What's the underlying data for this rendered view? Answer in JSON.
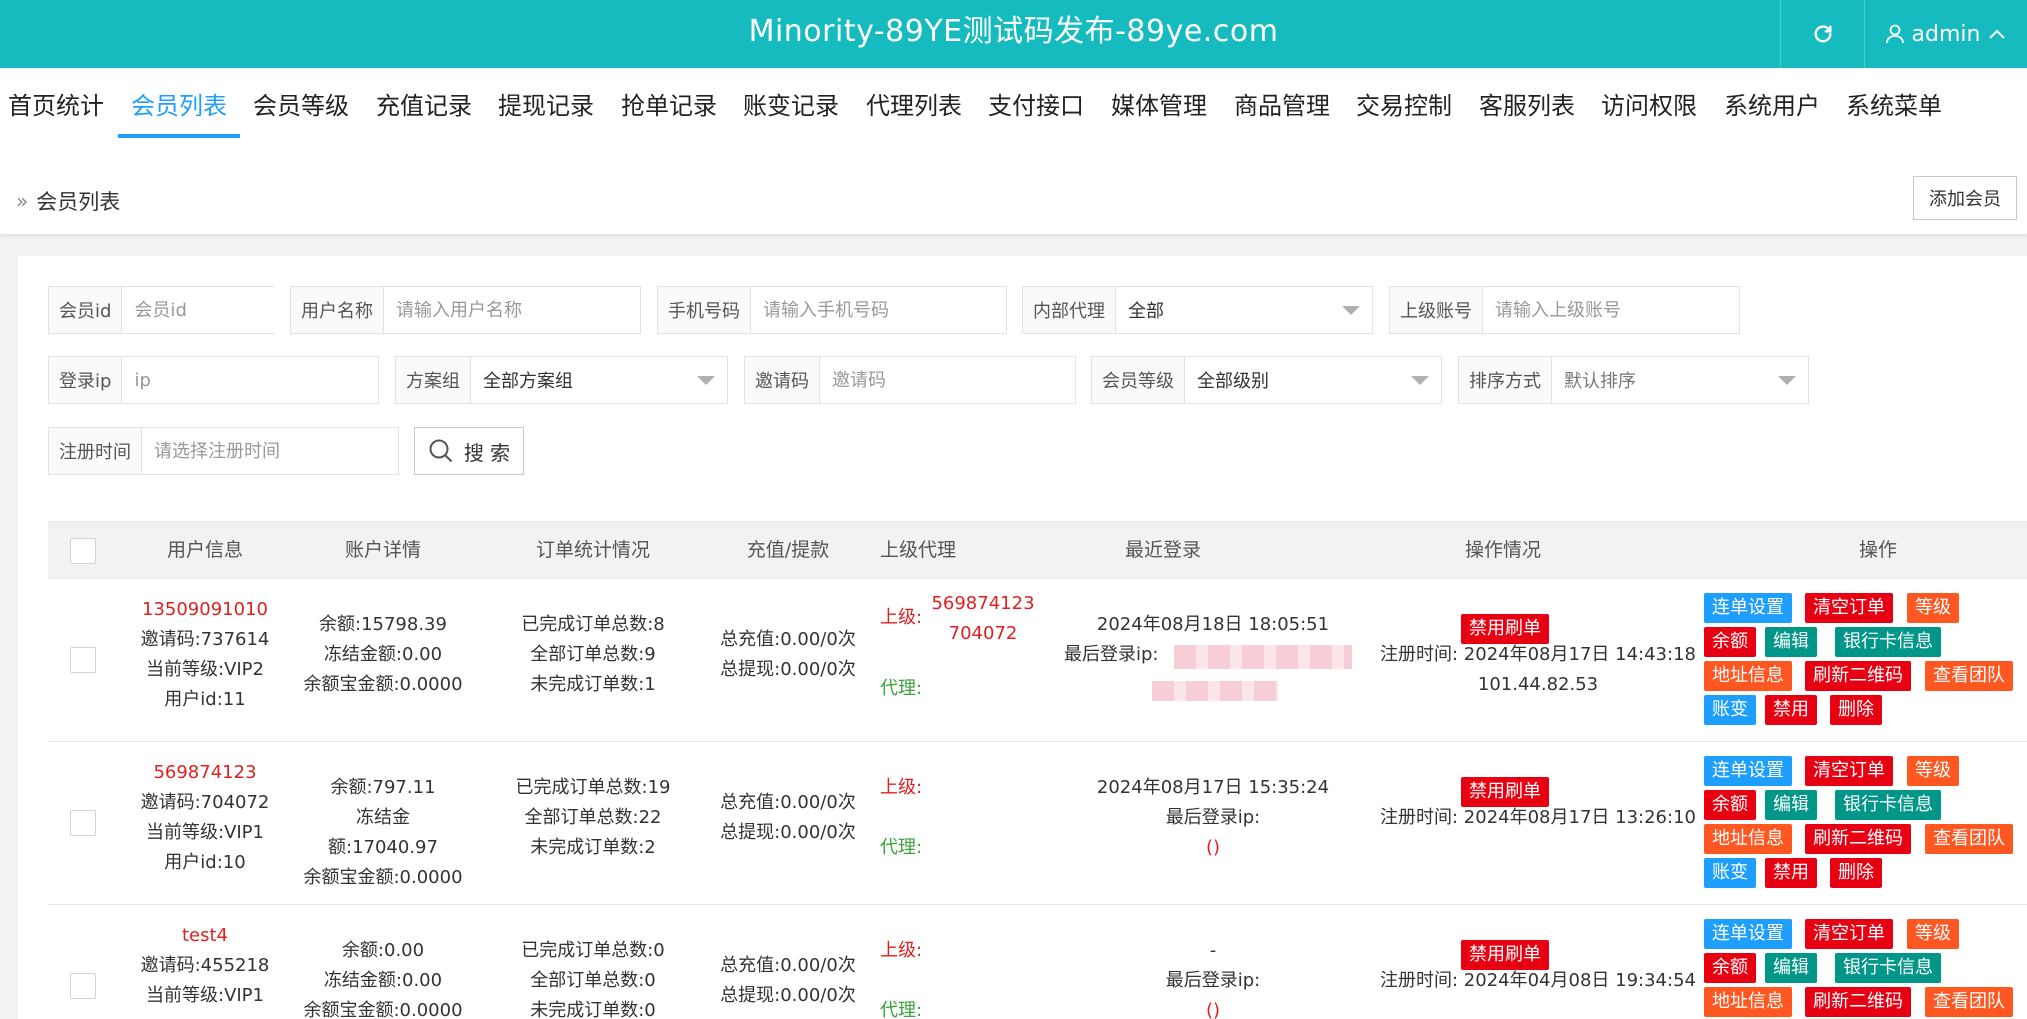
{
  "header": {
    "title": "Minority-89YE测试码发布-89ye.com",
    "user": "admin"
  },
  "nav": {
    "items": [
      "首页统计",
      "会员列表",
      "会员等级",
      "充值记录",
      "提现记录",
      "抢单记录",
      "账变记录",
      "代理列表",
      "支付接口",
      "媒体管理",
      "商品管理",
      "交易控制",
      "客服列表",
      "访问权限",
      "系统用户",
      "系统菜单"
    ],
    "active_index": 1
  },
  "breadcrumb": {
    "current": "会员列表"
  },
  "toolbar": {
    "add_member": "添加会员"
  },
  "filters": {
    "member_id": {
      "label": "会员id",
      "placeholder": "会员id"
    },
    "username": {
      "label": "用户名称",
      "placeholder": "请输入用户名称"
    },
    "phone": {
      "label": "手机号码",
      "placeholder": "请输入手机号码"
    },
    "internal_agent": {
      "label": "内部代理",
      "value": "全部"
    },
    "parent_account": {
      "label": "上级账号",
      "placeholder": "请输入上级账号"
    },
    "login_ip": {
      "label": "登录ip",
      "placeholder": "ip"
    },
    "plan_group": {
      "label": "方案组",
      "value": "全部方案组"
    },
    "invite_code": {
      "label": "邀请码",
      "placeholder": "邀请码"
    },
    "member_level": {
      "label": "会员等级",
      "value": "全部级别"
    },
    "sort": {
      "label": "排序方式",
      "value": "默认排序"
    },
    "register_time": {
      "label": "注册时间",
      "placeholder": "请选择注册时间"
    },
    "search_button": "搜 索"
  },
  "table": {
    "headers": [
      "用户信息",
      "账户详情",
      "订单统计情况",
      "充值/提款",
      "上级代理",
      "最近登录",
      "操作情况",
      "操作"
    ],
    "rows": [
      {
        "name": "13509091010",
        "invite": "邀请码:737614",
        "level": "当前等级:VIP2",
        "uid": "用户id:11",
        "balance": "余额:15798.39",
        "frozen": "冻结金额:0.00",
        "yeb": "余额宝金额:0.0000",
        "done": "已完成订单总数:8",
        "total": "全部订单总数:9",
        "undone": "未完成订单数:1",
        "recharge": "总充值:0.00/0次",
        "withdraw": "总提现:0.00/0次",
        "parent_label": "上级:",
        "parent_value": "569874123",
        "parent_value2": "704072",
        "agent_label": "代理:",
        "last_login_time": "2024年08月18日 18:05:51",
        "last_login_ip_label": "最后登录ip:",
        "last_login_ip": "",
        "ban_label": "禁用刷单",
        "reg_time": "注册时间: 2024年08月17日 14:43:18",
        "reg_ip": "101.44.82.53"
      },
      {
        "name": "569874123",
        "invite": "邀请码:704072",
        "level": "当前等级:VIP1",
        "uid": "用户id:10",
        "balance": "余额:797.11",
        "frozen": "冻结金额:17040.97",
        "yeb": "余额宝金额:0.0000",
        "done": "已完成订单总数:19",
        "total": "全部订单总数:22",
        "undone": "未完成订单数:2",
        "recharge": "总充值:0.00/0次",
        "withdraw": "总提现:0.00/0次",
        "parent_label": "上级:",
        "parent_value": "",
        "parent_value2": "",
        "agent_label": "代理:",
        "last_login_time": "2024年08月17日 15:35:24",
        "last_login_ip_label": "最后登录ip:",
        "last_login_ip": "()",
        "ban_label": "禁用刷单",
        "reg_time": "注册时间: 2024年08月17日 13:26:10",
        "reg_ip": ""
      },
      {
        "name": "test4",
        "invite": "邀请码:455218",
        "level": "当前等级:VIP1",
        "uid": "",
        "balance": "余额:0.00",
        "frozen": "冻结金额:0.00",
        "yeb": "余额宝金额:0.0000",
        "done": "已完成订单总数:0",
        "total": "全部订单总数:0",
        "undone": "未完成订单数:0",
        "recharge": "总充值:0.00/0次",
        "withdraw": "总提现:0.00/0次",
        "parent_label": "上级:",
        "parent_value": "",
        "parent_value2": "",
        "agent_label": "代理:",
        "last_login_time": "-",
        "last_login_ip_label": "最后登录ip:",
        "last_login_ip": "()",
        "ban_label": "禁用刷单",
        "reg_time": "注册时间: 2024年04月08日 19:34:54",
        "reg_ip": ""
      }
    ],
    "actions": {
      "order_setting": "连单设置",
      "clear_orders": "清空订单",
      "level": "等级",
      "balance": "余额",
      "edit": "编辑",
      "bank_info": "银行卡信息",
      "address_info": "地址信息",
      "refresh_qr": "刷新二维码",
      "view_team": "查看团队",
      "account_change": "账变",
      "ban": "禁用",
      "delete": "删除"
    }
  },
  "colors": {
    "header_bg": "#16bbbf",
    "active_tab": "#1e9fff",
    "btn_blue": "#1e9fff",
    "btn_red": "#e60012",
    "btn_orange": "#ff5722",
    "btn_teal": "#009688"
  },
  "icons": {
    "refresh": "refresh-icon",
    "user": "user-icon",
    "chevron": "chevron-up-icon",
    "breadcrumb": "double-chevron-right-icon",
    "search": "search-icon"
  }
}
